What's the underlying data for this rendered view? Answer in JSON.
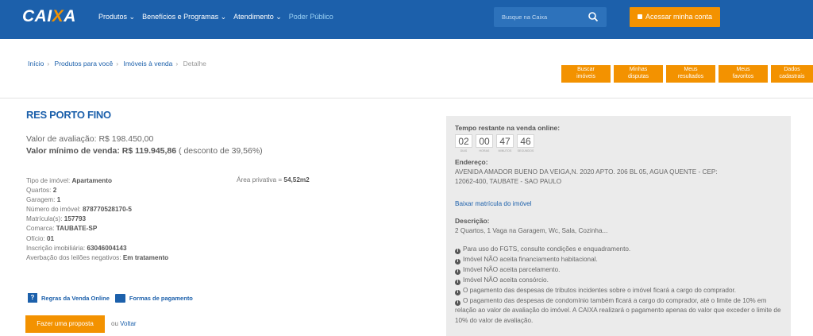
{
  "header": {
    "logo_main": "CAI",
    "logo_x": "X",
    "logo_end": "A",
    "nav": [
      "Produtos",
      "Benefícios e Programas",
      "Atendimento"
    ],
    "nav_poder": "Poder Público",
    "search_placeholder": "Busque na Caixa",
    "login_label": "Acessar minha conta",
    "colors": {
      "header": "#1c60ab",
      "accent": "#f39200"
    }
  },
  "breadcrumb": {
    "items": [
      "Início",
      "Produtos para você",
      "Imóveis à venda"
    ],
    "current": "Detalhe"
  },
  "top_buttons": [
    [
      "Buscar",
      "imóveis"
    ],
    [
      "Minhas",
      "disputas"
    ],
    [
      "Meus",
      "resultados"
    ],
    [
      "Meus",
      "favoritos"
    ],
    [
      "Dados",
      "cadastrais"
    ]
  ],
  "property": {
    "title": "RES PORTO FINO",
    "aval_label": "Valor de avaliação:",
    "aval_value": "R$ 198.450,00",
    "min_label": "Valor mínimo de venda:",
    "min_value": "R$ 119.945,86",
    "discount": "( desconto de 39,56%)",
    "area_label": "Área privativa =",
    "area_value": "54,52m2",
    "details": [
      {
        "label": "Tipo de imóvel:",
        "value": "Apartamento"
      },
      {
        "label": "Quartos:",
        "value": "2"
      },
      {
        "label": "Garagem:",
        "value": "1"
      },
      {
        "label": "Número do imóvel:",
        "value": "878770528170-5"
      },
      {
        "label": "Matrícula(s):",
        "value": "157793"
      },
      {
        "label": "Comarca:",
        "value": "TAUBATE-SP"
      },
      {
        "label": "Ofício:",
        "value": "01"
      },
      {
        "label": "Inscrição imobiliária:",
        "value": "63046004143"
      },
      {
        "label": "Averbação dos leilões negativos:",
        "value": "Em tratamento"
      }
    ],
    "rules_link": "Regras da Venda Online",
    "payment_link": "Formas de pagamento",
    "proposal_button": "Fazer uma proposta",
    "or_text": "ou",
    "back_link": "Voltar"
  },
  "panel": {
    "time_label": "Tempo restante na venda online:",
    "timer": [
      {
        "num": "02",
        "label": "DIAS"
      },
      {
        "num": "00",
        "label": "HORAS"
      },
      {
        "num": "47",
        "label": "MINUTOS"
      },
      {
        "num": "46",
        "label": "SEGUNDOS"
      }
    ],
    "address_label": "Endereço:",
    "address_line1": "AVENIDA AMADOR BUENO DA VEIGA,N. 2020 APTO. 206 BL 05, AGUA QUENTE - CEP:",
    "address_line2": "12062-400, TAUBATE - SAO PAULO",
    "matricula_link": "Baixar matrícula do imóvel",
    "desc_label": "Descrição:",
    "desc_text": "2 Quartos, 1 Vaga na Garagem, Wc, Sala, Cozinha...",
    "notes": [
      "Para uso do FGTS, consulte condições e enquadramento.",
      "Imóvel NÃO aceita financiamento habitacional.",
      "Imóvel NÃO aceita parcelamento.",
      "Imóvel NÃO aceita consórcio.",
      "O pagamento das despesas de tributos incidentes sobre o imóvel ficará a cargo do comprador.",
      "O pagamento das despesas de condomínio também ficará a cargo do comprador, até o limite de 10% em relação ao valor de avaliação do imóvel. A CAIXA realizará o pagamento apenas do valor que exceder o limite de 10% do valor de avaliação."
    ]
  }
}
